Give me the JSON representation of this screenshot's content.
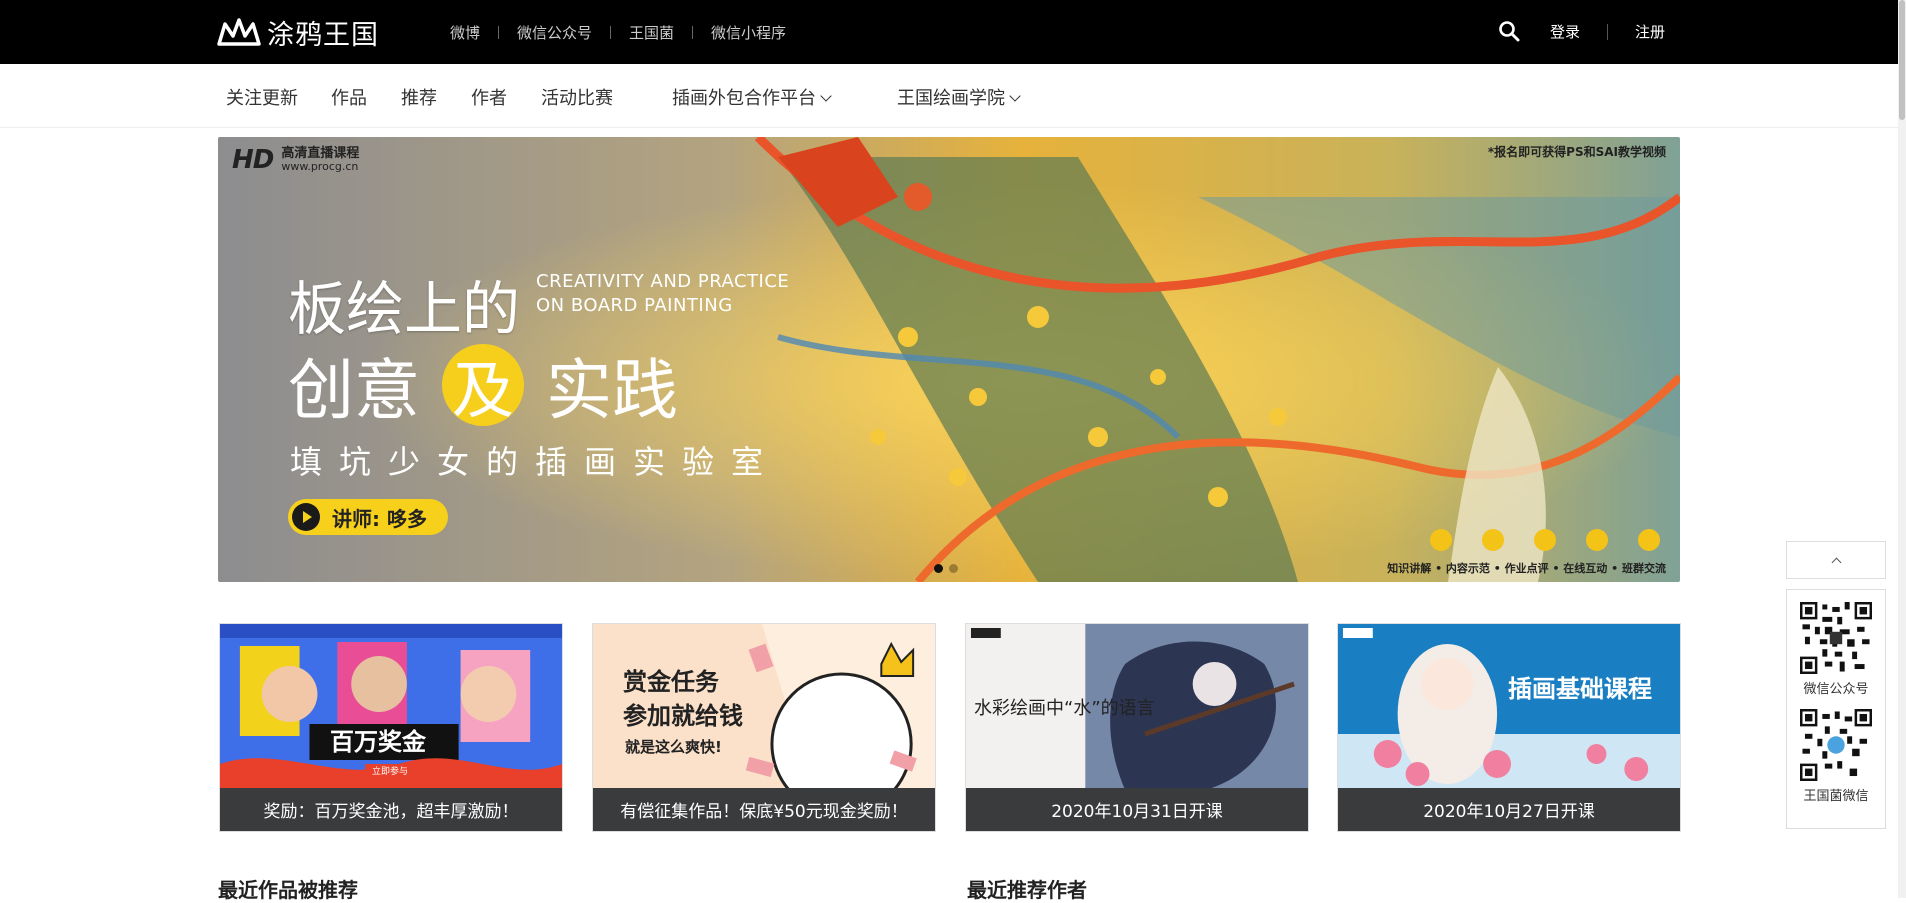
{
  "brand": {
    "name": "涂鸦王国"
  },
  "topnav": {
    "items": [
      {
        "label": "微博"
      },
      {
        "label": "微信公众号"
      },
      {
        "label": "王国菌"
      },
      {
        "label": "微信小程序"
      }
    ]
  },
  "auth": {
    "login": "登录",
    "register": "注册"
  },
  "secnav": {
    "items": [
      {
        "label": "关注更新"
      },
      {
        "label": "作品"
      },
      {
        "label": "推荐"
      },
      {
        "label": "作者"
      },
      {
        "label": "活动比赛"
      },
      {
        "label": "插画外包合作平台"
      },
      {
        "label": "王国绘画学院"
      }
    ]
  },
  "banner": {
    "hd_logo": "HD",
    "hd_title": "高清直播课程",
    "hd_url": "www.procg.cn",
    "note": "*报名即可获得PS和SAI教学视频",
    "headline1": "板绘上的",
    "headline_en_1": "CREATIVITY AND PRACTICE",
    "headline_en_2": "ON BOARD PAINTING",
    "headline2_a": "创意",
    "headline2_b": "及",
    "headline2_c": "实践",
    "subhead": "填坑少女的插画实验室",
    "teacher": "讲师: 哆多",
    "features": "知识讲解 • 内容示范 • 作业点评 • 在线互动 • 班群交流",
    "slides": 2,
    "active_slide": 1
  },
  "cards": [
    {
      "caption": "奖励：百万奖金池，超丰厚激励！"
    },
    {
      "caption": "有偿征集作品！保底¥50元现金奖励！"
    },
    {
      "caption": "2020年10月31日开课"
    },
    {
      "caption": "2020年10月27日开课"
    }
  ],
  "card_art": [
    {
      "text1": "百万奖金",
      "text2": "立即参与"
    },
    {
      "text1": "赏金任务",
      "text2": "参加就给钱",
      "text3": "就是这么爽快!"
    },
    {
      "text1": "水彩绘画中“水”的语言"
    },
    {
      "text1": "插画基础课程"
    }
  ],
  "sections": {
    "left": "最近作品被推荐",
    "right": "最近推荐作者"
  },
  "right_tools": {
    "qr1_label": "微信公众号",
    "qr2_label": "王国菌微信"
  },
  "colors": {
    "topbar": "#000000",
    "accent_yellow": "#f6cf1d",
    "caption_bg": "#3a3b3d"
  }
}
